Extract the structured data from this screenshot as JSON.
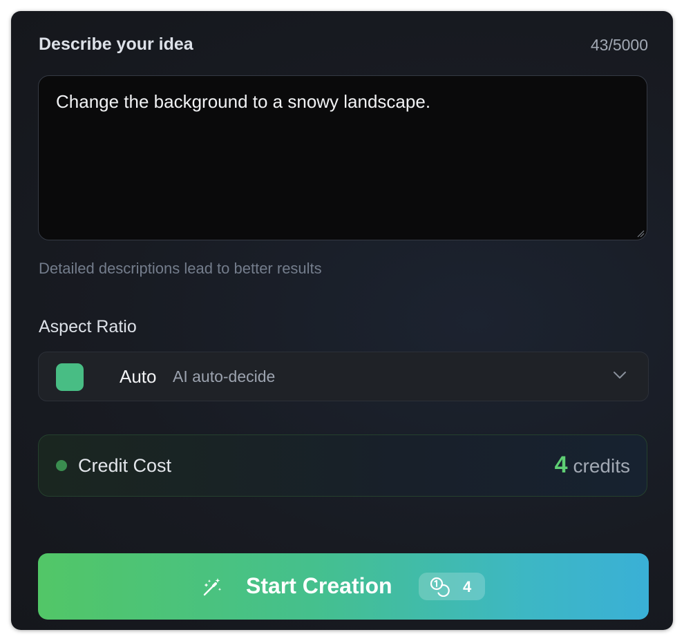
{
  "prompt": {
    "title": "Describe your idea",
    "char_count": "43/5000",
    "text": "Change the background to a snowy landscape.",
    "hint": "Detailed descriptions lead to better results"
  },
  "aspect_ratio": {
    "label": "Aspect Ratio",
    "value": "Auto",
    "description": "AI auto-decide",
    "swatch_color": "#48bd84"
  },
  "credit": {
    "label": "Credit Cost",
    "amount": "4",
    "unit": "credits",
    "accent_color": "#5fcf74"
  },
  "start_button": {
    "label": "Start Creation",
    "cost": "4",
    "icon": "magic-wand-icon",
    "gradient": [
      "#52c667",
      "#3ab0d6"
    ]
  }
}
